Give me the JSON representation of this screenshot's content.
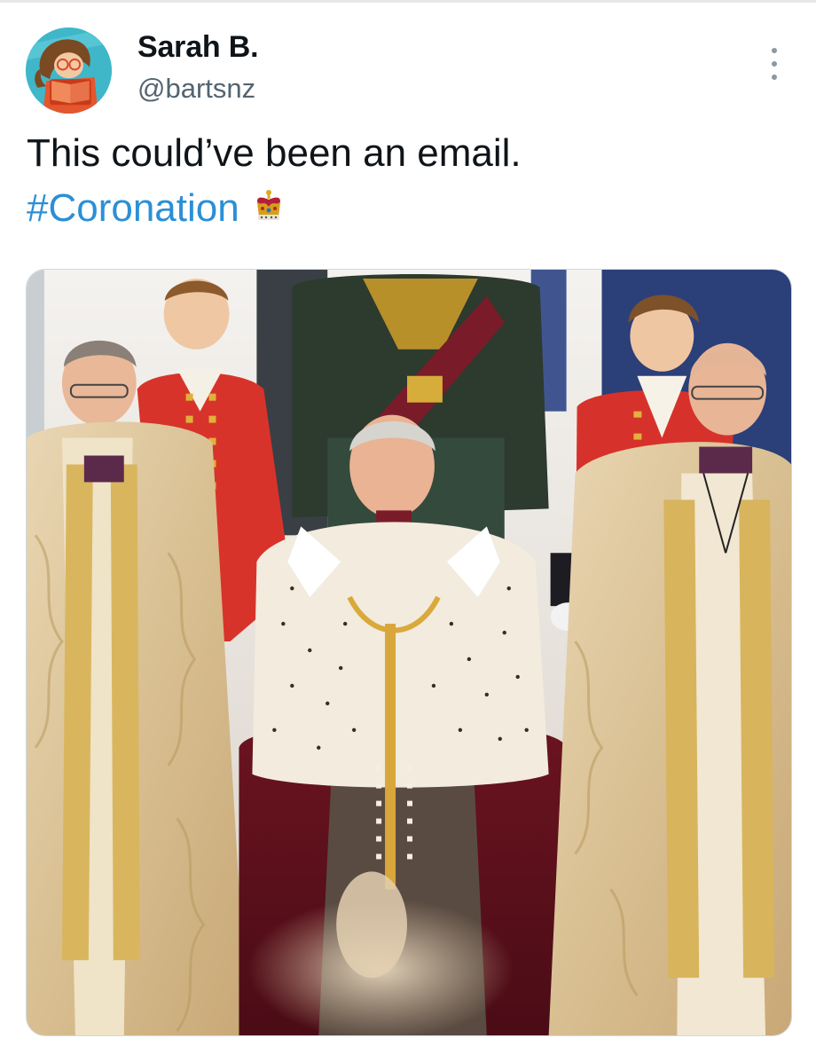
{
  "author": {
    "display_name": "Sarah B.",
    "handle": "@bartsnz",
    "avatar_icon": "cartoon-person-reading-avatar"
  },
  "tweet": {
    "line1": "This could’ve been an email.",
    "hashtag": "#Coronation",
    "emoji_icon": "crown-emoji"
  },
  "media": {
    "kind": "photo",
    "subject_icon": "coronation-procession-photo"
  },
  "colors": {
    "hashtag": "#2b8fd6",
    "handle": "#536471",
    "text": "#0f1419"
  }
}
